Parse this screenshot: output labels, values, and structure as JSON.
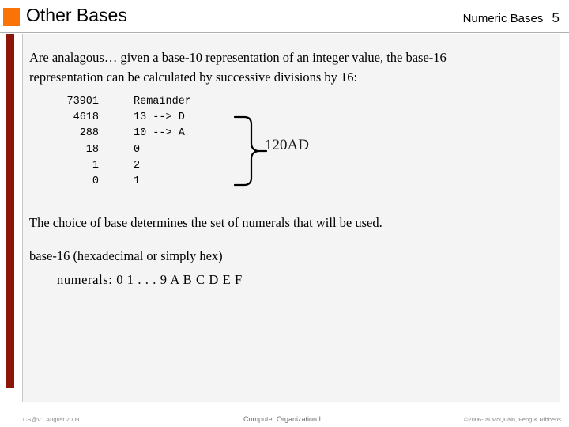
{
  "header": {
    "title": "Other Bases",
    "unit_name": "Numeric Bases",
    "slide_number": "5",
    "bullet_color": "#f97306",
    "accent_bar_color": "#8c1408"
  },
  "content": {
    "intro_paragraph": "Are analagous… given a base-10 representation of an integer value, the base-16 representation can be calculated by successive divisions by 16:",
    "division_table": {
      "quotient_header": "",
      "remainder_header": "Remainder",
      "rows": [
        {
          "quotient": "73901",
          "remainder": ""
        },
        {
          "quotient": "4618",
          "remainder": "13 --> D"
        },
        {
          "quotient": "288",
          "remainder": "10 --> A"
        },
        {
          "quotient": "18",
          "remainder": "0"
        },
        {
          "quotient": "1",
          "remainder": "2"
        },
        {
          "quotient": "0",
          "remainder": "1"
        }
      ]
    },
    "result_label": "120AD",
    "choice_line": "The choice of base determines the set of numerals that will be used.",
    "base16_line": "base-16 (hexadecimal or simply hex)",
    "numerals_line": "numerals:  0 1 . . . 9  A  B  C  D  E  F"
  },
  "footer": {
    "left": "CS@VT August 2009",
    "center": "Computer Organization I",
    "right": "©2006-09 McQuain, Feng & Ribbens"
  }
}
